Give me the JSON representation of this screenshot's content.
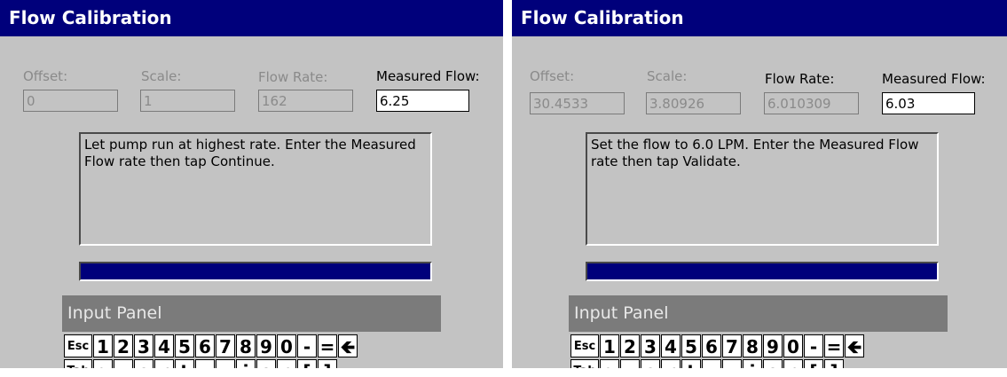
{
  "left": {
    "title": "Flow Calibration",
    "labels": {
      "offset": "Offset:",
      "scale": "Scale:",
      "flow_rate": "Flow Rate:",
      "measured_flow": "Measured Flow:"
    },
    "values": {
      "offset": "0",
      "scale": "1",
      "flow_rate": "162",
      "measured_flow": "6.25"
    },
    "message": "Let pump run at highest rate.  Enter the Measured Flow rate then tap Continue.",
    "progress_percent": 100,
    "input_panel": {
      "title": "Input Panel",
      "row1": [
        "Esc",
        "1",
        "2",
        "3",
        "4",
        "5",
        "6",
        "7",
        "8",
        "9",
        "0",
        "-",
        "=",
        "back-arrow-icon"
      ],
      "row2": [
        "Tab",
        "q",
        "w",
        "e",
        "r",
        "t",
        "y",
        "u",
        "i",
        "o",
        "p",
        "[",
        "]"
      ]
    }
  },
  "right": {
    "title": "Flow Calibration",
    "labels": {
      "offset": "Offset:",
      "scale": "Scale:",
      "flow_rate": "Flow Rate:",
      "measured_flow": "Measured Flow:"
    },
    "values": {
      "offset": "30.4533",
      "scale": "3.80926",
      "flow_rate": "6.010309",
      "measured_flow": "6.03"
    },
    "message": "Set the flow to  6.0 LPM.  Enter the Measured Flow rate then tap Validate.",
    "progress_percent": 100,
    "input_panel": {
      "title": "Input Panel",
      "row1": [
        "Esc",
        "1",
        "2",
        "3",
        "4",
        "5",
        "6",
        "7",
        "8",
        "9",
        "0",
        "-",
        "=",
        "back-arrow-icon"
      ],
      "row2": [
        "Tab",
        "q",
        "w",
        "e",
        "r",
        "t",
        "y",
        "u",
        "i",
        "o",
        "p",
        "[",
        "]"
      ]
    }
  },
  "colors": {
    "title_bar": "#00007b",
    "background": "#c3c3c3",
    "progress": "#00007b",
    "panel_title": "#7b7b7b"
  }
}
